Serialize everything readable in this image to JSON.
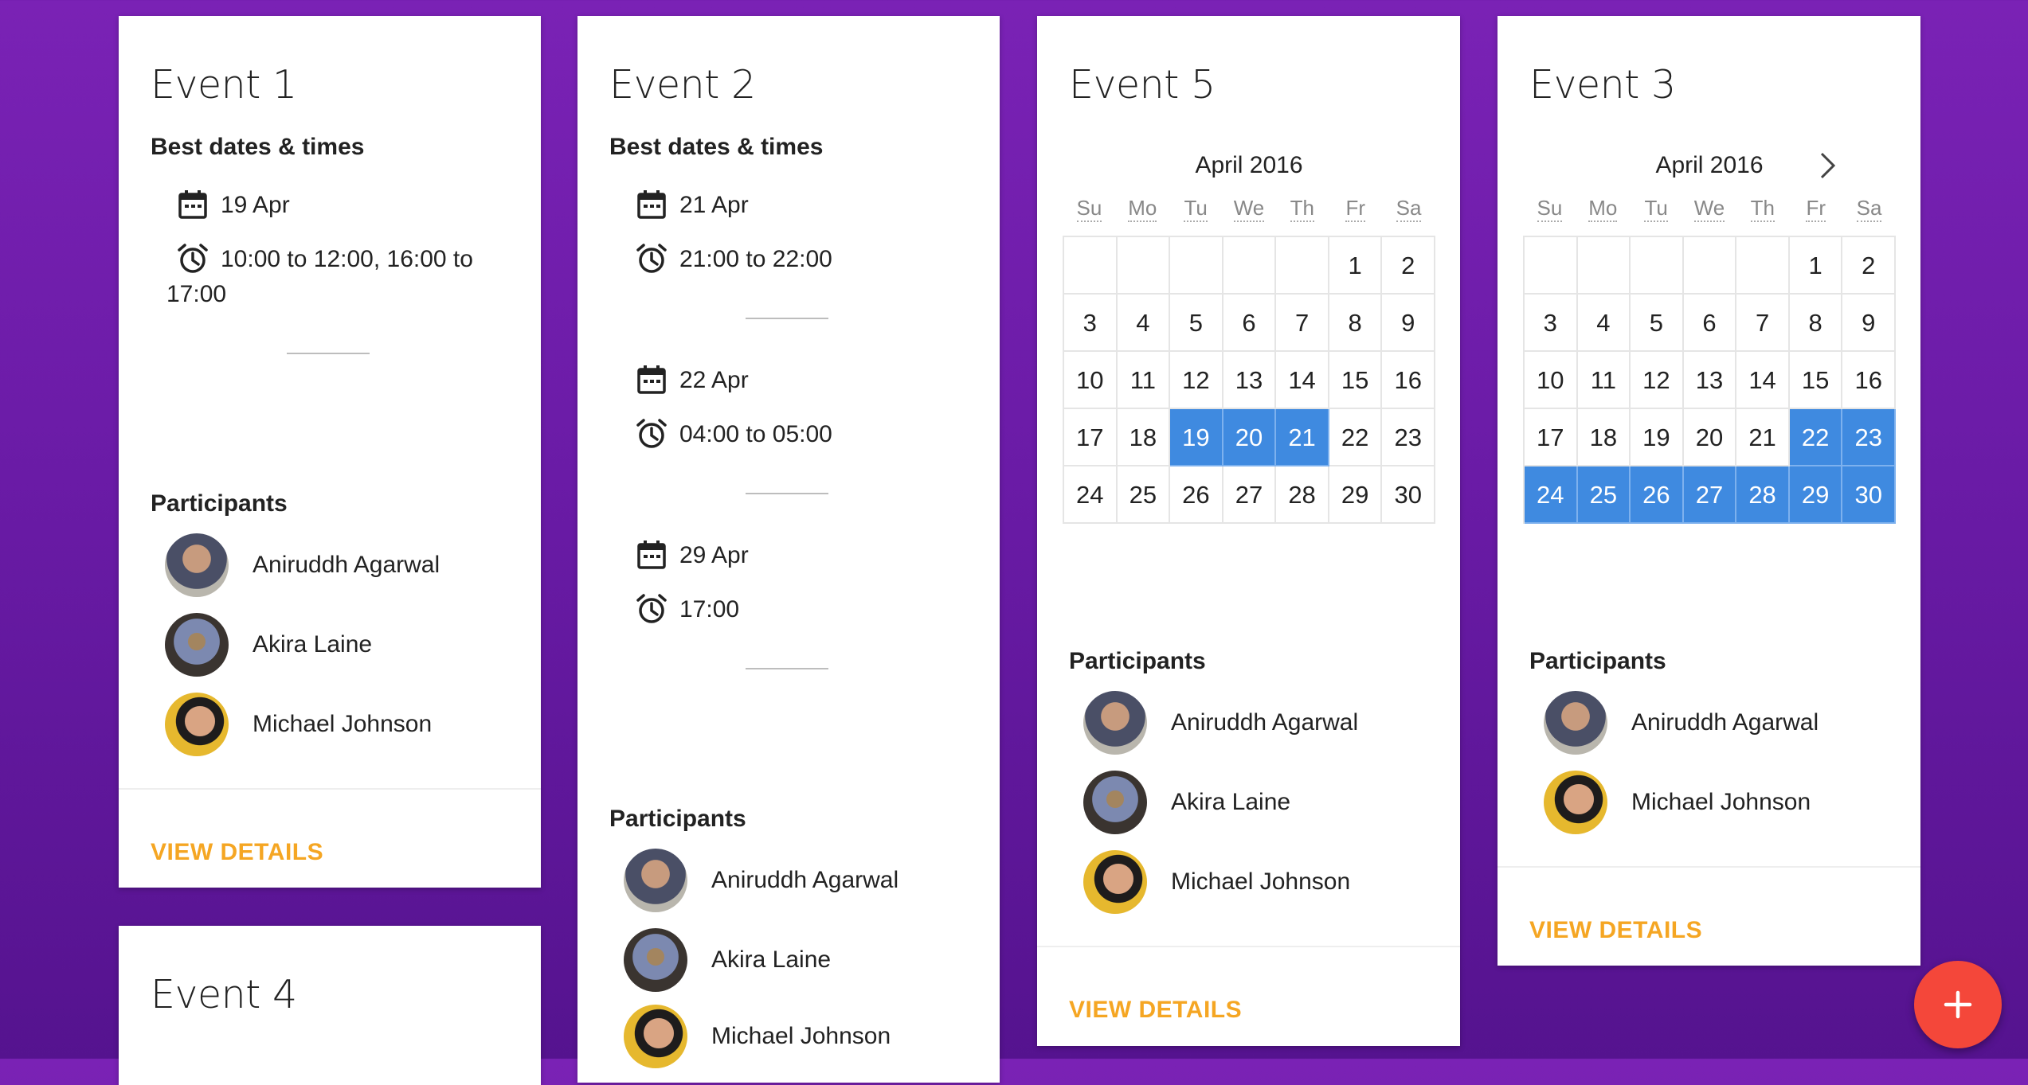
{
  "cards": {
    "event1": {
      "title": "Event 1",
      "best_label": "Best dates & times",
      "slots": [
        {
          "date": "19 Apr",
          "time": "10:00 to 12:00, 16:00 to 17:00"
        }
      ],
      "participants_label": "Participants",
      "participants": [
        "Aniruddh Agarwal",
        "Akira Laine",
        "Michael Johnson"
      ],
      "action": "VIEW DETAILS"
    },
    "event2": {
      "title": "Event 2",
      "best_label": "Best dates & times",
      "slots": [
        {
          "date": "21 Apr",
          "time": "21:00 to 22:00"
        },
        {
          "date": "22 Apr",
          "time": "04:00 to 05:00"
        },
        {
          "date": "29 Apr",
          "time": "17:00"
        }
      ],
      "participants_label": "Participants",
      "participants": [
        "Aniruddh Agarwal",
        "Akira Laine",
        "Michael Johnson"
      ]
    },
    "event5": {
      "title": "Event 5",
      "calendar": {
        "month": "April 2016",
        "weekdays": [
          "Su",
          "Mo",
          "Tu",
          "We",
          "Th",
          "Fr",
          "Sa"
        ],
        "leading_blanks": 5,
        "days": 30,
        "selected": [
          19,
          20,
          21
        ]
      },
      "participants_label": "Participants",
      "participants": [
        "Aniruddh Agarwal",
        "Akira Laine",
        "Michael Johnson"
      ],
      "action": "VIEW DETAILS"
    },
    "event3": {
      "title": "Event 3",
      "calendar": {
        "month": "April 2016",
        "weekdays": [
          "Su",
          "Mo",
          "Tu",
          "We",
          "Th",
          "Fr",
          "Sa"
        ],
        "leading_blanks": 5,
        "days": 30,
        "selected": [
          22,
          23,
          24,
          25,
          26,
          27,
          28,
          29,
          30
        ]
      },
      "participants_label": "Participants",
      "participants": [
        "Aniruddh Agarwal",
        "Michael Johnson"
      ],
      "action": "VIEW DETAILS"
    },
    "event4": {
      "title": "Event 4"
    }
  },
  "fab": {
    "icon": "plus-icon",
    "color": "#f4473a"
  },
  "colors": {
    "accent": "#f5a623",
    "selected_day": "#3f8ae0"
  }
}
